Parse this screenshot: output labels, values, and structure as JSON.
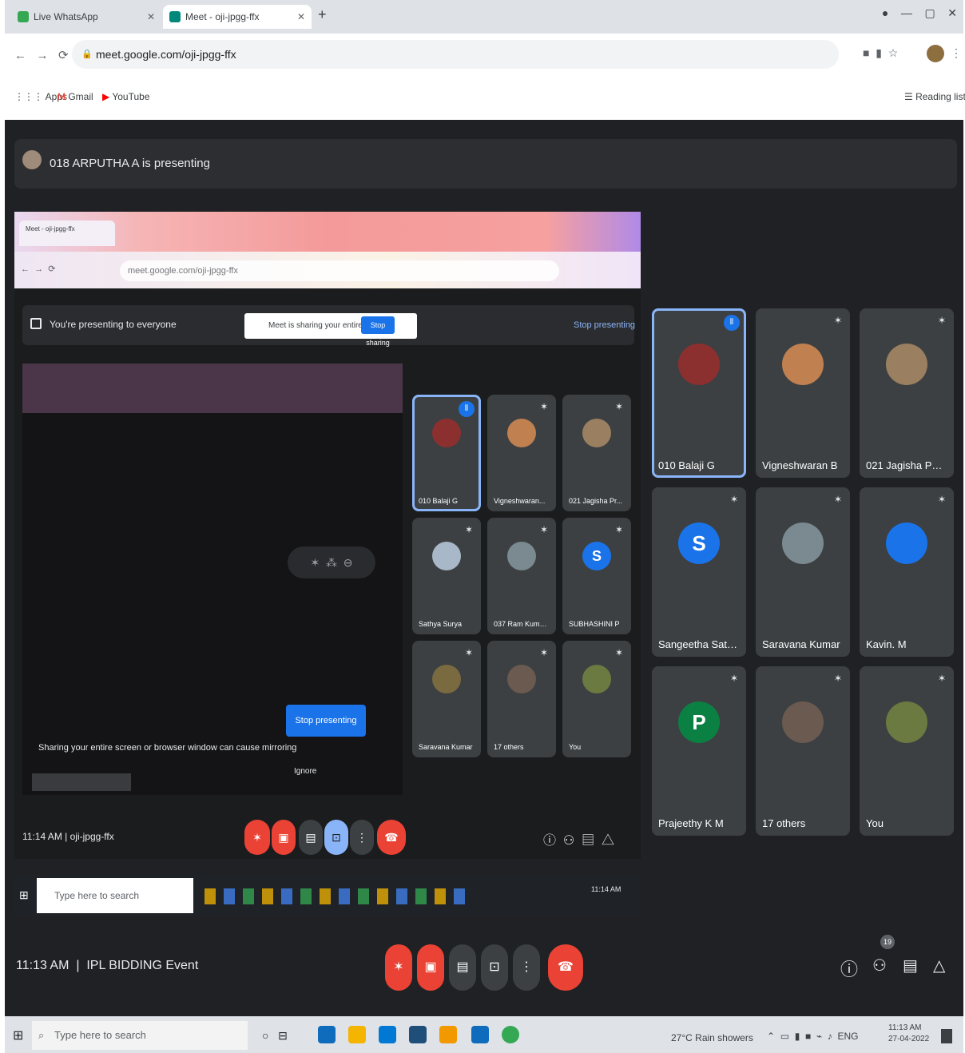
{
  "browser": {
    "tabs": [
      {
        "label": "Live WhatsApp"
      },
      {
        "label": "Meet - oji-jpgg-ffx"
      }
    ],
    "address": "meet.google.com/oji-jpgg-ffx",
    "bookmarks": [
      "Apps",
      "Gmail",
      "YouTube"
    ],
    "reading_list": "Reading list"
  },
  "meet": {
    "presenting_banner": "018 ARPUTHA A is presenting",
    "time": "11:13 AM",
    "meeting_name": "IPL BIDDING Event",
    "participants_badge": "19",
    "colors": {
      "accent": "#8ab4f8",
      "end_call": "#ea4335",
      "tile": "#3c4043",
      "background": "#202124"
    }
  },
  "shared_screen": {
    "omnibox": "meet.google.com/oji-jpgg-ffx",
    "presenting_text": "You're presenting to everyone",
    "chip_text": "Meet is sharing your entire screen",
    "chip_button": "Stop sharing",
    "stop_link": "Stop presenting",
    "stop_button": "Stop presenting",
    "warning": "Sharing your entire screen or browser window can cause mirroring",
    "ignore": "Ignore",
    "time": "11:14 AM",
    "meeting_code": "oji-jpgg-ffx",
    "taskbar_search": "Type here to search",
    "clock": "11:14 AM"
  },
  "grid_small": [
    {
      "name": "010 Balaji G",
      "speaking": true
    },
    {
      "name": "Vigneshwaran..."
    },
    {
      "name": "021 Jagisha Pr..."
    },
    {
      "name": "Sathya Surya"
    },
    {
      "name": "037 Ram Kumar..."
    },
    {
      "name": "SUBHASHINI P",
      "letter": "S"
    },
    {
      "name": "Saravana Kumar"
    },
    {
      "name": "17 others"
    },
    {
      "name": "You"
    }
  ],
  "grid_large": [
    {
      "name": "010 Balaji G",
      "speaking": true
    },
    {
      "name": "Vigneshwaran B"
    },
    {
      "name": "021 Jagisha Parv..."
    },
    {
      "name": "Sangeetha Sathish",
      "letter": "S"
    },
    {
      "name": "Saravana Kumar"
    },
    {
      "name": "Kavin. M"
    },
    {
      "name": "Prajeethy K M",
      "letter": "P"
    },
    {
      "name": "17 others"
    },
    {
      "name": "You"
    }
  ],
  "taskbar": {
    "search": "Type here to search",
    "weather": "27°C Rain showers",
    "time": "11:13 AM",
    "date": "27-04-2022"
  },
  "icons": [
    "windows-icon",
    "search-icon",
    "mic-off-icon",
    "camera-off-icon",
    "captions-icon",
    "present-icon",
    "more-icon",
    "end-call-icon",
    "info-icon",
    "people-icon",
    "chat-icon",
    "activities-icon"
  ]
}
